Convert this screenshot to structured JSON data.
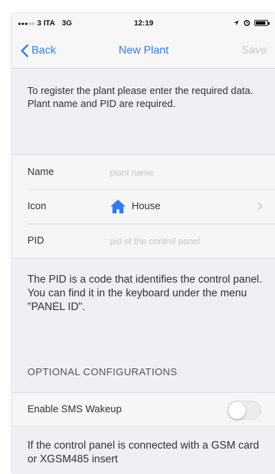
{
  "status_bar": {
    "carrier": "3 ITA",
    "network": "3G",
    "time": "12:19",
    "battery_level": 0.85
  },
  "nav": {
    "back_label": "Back",
    "title": "New Plant",
    "save_label": "Save"
  },
  "intro_text": "To register the plant please enter the required data. Plant name and PID are required.",
  "form": {
    "name": {
      "label": "Name",
      "placeholder": "plant name"
    },
    "icon": {
      "label": "Icon",
      "value": "House",
      "icon": "house-icon"
    },
    "pid": {
      "label": "PID",
      "placeholder": "pid of the control panel"
    }
  },
  "pid_info": "The PID is a code that identifies the control panel. You can find it in the keyboard under the menu \"PANEL ID\".",
  "optional": {
    "header": "OPTIONAL CONFIGURATIONS",
    "sms_wakeup": {
      "label": "Enable SMS Wakeup",
      "enabled": false
    }
  },
  "sms_info": "If the control panel is connected with a GSM card or XGSM485 insert",
  "colors": {
    "accent": "#2f7cf6",
    "disabled": "#c8c8cc",
    "background": "#efeff4"
  }
}
